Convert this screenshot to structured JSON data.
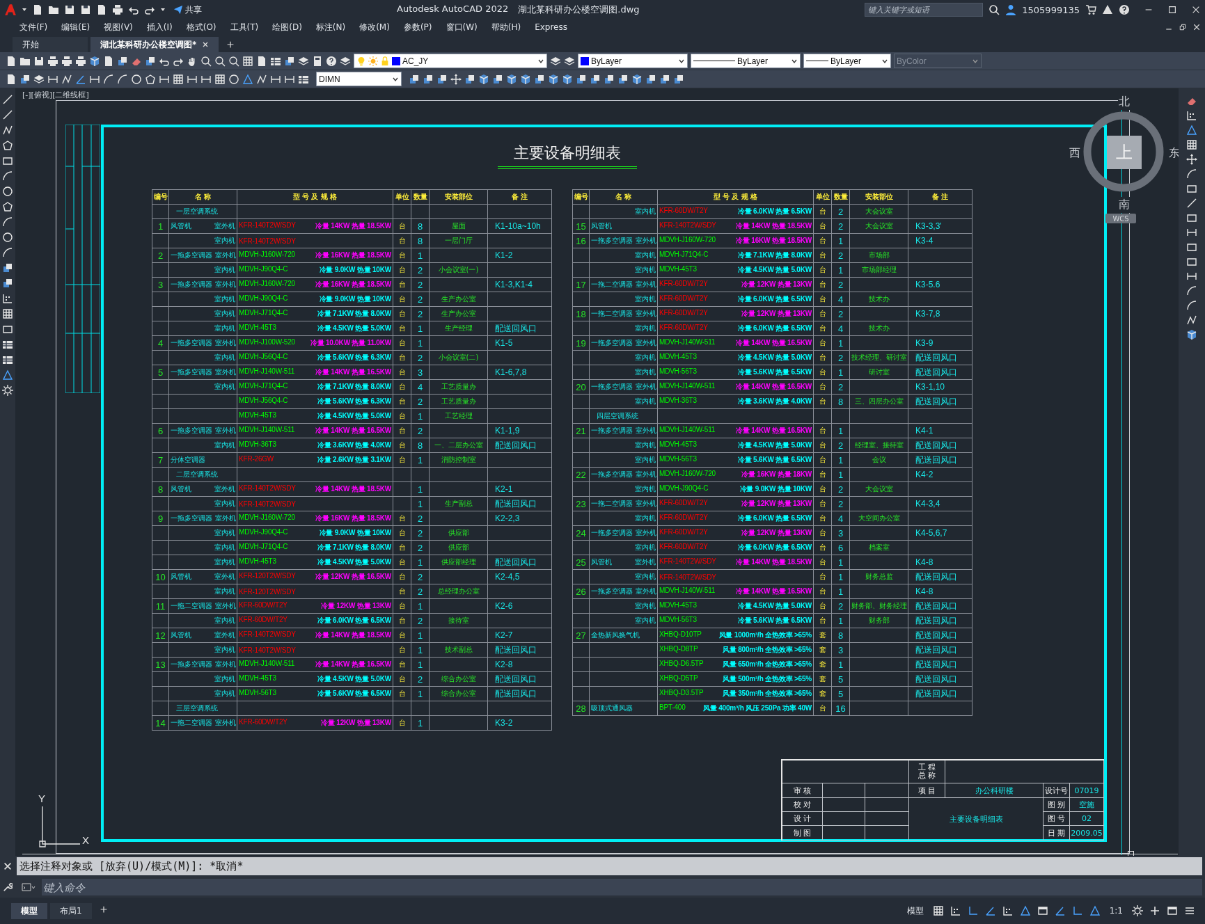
{
  "title_bar": {
    "share_label": "共享",
    "app_title": "Autodesk AutoCAD 2022",
    "file_name": "湖北某科研办公楼空调图.dwg",
    "search_placeholder": "键入关键字或短语",
    "user_name": "1505999135"
  },
  "menu": [
    "文件(F)",
    "编辑(E)",
    "视图(V)",
    "插入(I)",
    "格式(O)",
    "工具(T)",
    "绘图(D)",
    "标注(N)",
    "修改(M)",
    "参数(P)",
    "窗口(W)",
    "帮助(H)",
    "Express"
  ],
  "doc_tabs": [
    {
      "label": "开始",
      "selected": false
    },
    {
      "label": "湖北某科研办公楼空调图*",
      "selected": true
    }
  ],
  "toolbar": {
    "layer": "AC_JY",
    "color_value": "ByLayer",
    "swatch": {
      "color": "#0000ff"
    },
    "linetype": "ByLayer",
    "lineweight": "ByLayer",
    "plot_style": {
      "label": "ByColor",
      "disabled": true
    },
    "dim_style": "DIMN"
  },
  "viewport_label": "[-][俯视][二维线框]",
  "drawing": {
    "title": "主要设备明细表",
    "tables": [
      {
        "columns": [
          "编号",
          "名 称",
          "型 号 及 规 格",
          "单位",
          "数量",
          "安装部位",
          "备 注"
        ],
        "rows": [
          {
            "kind": "section",
            "name": "一层空调系统"
          },
          {
            "kind": "item",
            "no": "1",
            "name": "风管机",
            "sub": "室外机",
            "model": {
              "text": "KFR-140T2W/SDY",
              "color": "#ff0000"
            },
            "spec": {
              "text": "冷量 14KW 热量 18.5KW",
              "color": "#ff00ff"
            },
            "unit": "台",
            "qty": "8",
            "location": "屋面",
            "remark": "K1-10a~10h"
          },
          {
            "kind": "item",
            "sub": "室内机",
            "model": {
              "text": "KFR-140T2W/SDY",
              "color": "#ff0000"
            },
            "unit": "台",
            "qty": "8",
            "location": "一层门厅"
          },
          {
            "kind": "item",
            "no": "2",
            "name": "一拖多空调器",
            "sub": "室外机",
            "model": {
              "text": "MDVH-J160W-720",
              "color": "#00ff00"
            },
            "spec": {
              "text": "冷量 16KW 热量 18.5KW",
              "color": "#ff00ff"
            },
            "unit": "台",
            "qty": "1",
            "remark": "K1-2"
          },
          {
            "kind": "item",
            "sub": "室内机",
            "model": {
              "text": "MDVH-J90Q4-C",
              "color": "#00ff00"
            },
            "spec": {
              "text": "冷量 9.0KW 热量 10KW",
              "color": "#00ffff"
            },
            "unit": "台",
            "qty": "2",
            "location": "小会议室(一)"
          },
          {
            "kind": "item",
            "no": "3",
            "name": "一拖多空调器",
            "sub": "室外机",
            "model": {
              "text": "MDVH-J160W-720",
              "color": "#00ff00"
            },
            "spec": {
              "text": "冷量 16KW 热量 18.5KW",
              "color": "#ff00ff"
            },
            "unit": "台",
            "qty": "2",
            "remark": "K1-3,K1-4"
          },
          {
            "kind": "item",
            "sub": "室内机",
            "model": {
              "text": "MDVH-J90Q4-C",
              "color": "#00ff00"
            },
            "spec": {
              "text": "冷量 9.0KW 热量 10KW",
              "color": "#00ffff"
            },
            "unit": "台",
            "qty": "2",
            "location": "生产办公室"
          },
          {
            "kind": "item",
            "sub": "室内机",
            "model": {
              "text": "MDVH-J71Q4-C",
              "color": "#00ff00"
            },
            "spec": {
              "text": "冷量 7.1KW 热量 8.0KW",
              "color": "#00ffff"
            },
            "unit": "台",
            "qty": "2",
            "location": "生产办公室"
          },
          {
            "kind": "item",
            "sub": "室内机",
            "model": {
              "text": "MDVH-45T3",
              "color": "#00ff00"
            },
            "spec": {
              "text": "冷量 4.5KW 热量 5.0KW",
              "color": "#00ffff"
            },
            "unit": "台",
            "qty": "1",
            "location": "生产经理",
            "remark": "配送回风口"
          },
          {
            "kind": "item",
            "no": "4",
            "name": "一拖多空调器",
            "sub": "室外机",
            "model": {
              "text": "MDVH-J100W-520",
              "color": "#00ff00"
            },
            "spec": {
              "text": "冷量 10.0KW 热量 11.0KW",
              "color": "#ff00ff"
            },
            "unit": "台",
            "qty": "1",
            "remark": "K1-5"
          },
          {
            "kind": "item",
            "sub": "室内机",
            "model": {
              "text": "MDVH-J56Q4-C",
              "color": "#00ff00"
            },
            "spec": {
              "text": "冷量 5.6KW 热量 6.3KW",
              "color": "#00ffff"
            },
            "unit": "台",
            "qty": "2",
            "location": "小会议室(二)"
          },
          {
            "kind": "item",
            "no": "5",
            "name": "一拖多空调器",
            "sub": "室外机",
            "model": {
              "text": "MDVH-J140W-511",
              "color": "#00ff00"
            },
            "spec": {
              "text": "冷量 14KW 热量 16.5KW",
              "color": "#ff00ff"
            },
            "unit": "台",
            "qty": "3",
            "remark": "K1-6,7,8"
          },
          {
            "kind": "item",
            "sub": "室内机",
            "model": {
              "text": "MDVH-J71Q4-C",
              "color": "#00ff00"
            },
            "spec": {
              "text": "冷量 7.1KW 热量 8.0KW",
              "color": "#00ffff"
            },
            "unit": "台",
            "qty": "4",
            "location": "工艺质量办"
          },
          {
            "kind": "item",
            "model": {
              "text": "MDVH-J56Q4-C",
              "color": "#00ff00"
            },
            "spec": {
              "text": "冷量 5.6KW 热量 6.3KW",
              "color": "#00ffff"
            },
            "unit": "台",
            "qty": "2",
            "location": "工艺质量办"
          },
          {
            "kind": "item",
            "model": {
              "text": "MDVH-45T3",
              "color": "#00ff00"
            },
            "spec": {
              "text": "冷量 4.5KW 热量 5.0KW",
              "color": "#00ffff"
            },
            "unit": "台",
            "qty": "1",
            "location": "工艺经理"
          },
          {
            "kind": "item",
            "no": "6",
            "name": "一拖多空调器",
            "sub": "室外机",
            "model": {
              "text": "MDVH-J140W-511",
              "color": "#00ff00"
            },
            "spec": {
              "text": "冷量 14KW 热量 16.5KW",
              "color": "#ff00ff"
            },
            "unit": "台",
            "qty": "2",
            "remark": "K1-1,9"
          },
          {
            "kind": "item",
            "sub": "室内机",
            "model": {
              "text": "MDVH-36T3",
              "color": "#00ff00"
            },
            "spec": {
              "text": "冷量 3.6KW 热量 4.0KW",
              "color": "#00ffff"
            },
            "unit": "台",
            "qty": "8",
            "location": "一、二层办公室",
            "remark": "配送回风口"
          },
          {
            "kind": "item",
            "no": "7",
            "name": "分体空调器",
            "model": {
              "text": "KFR-26GW",
              "color": "#ff0000"
            },
            "spec": {
              "text": "冷量 2.6KW 热量 3.1KW",
              "color": "#00ffff"
            },
            "unit": "台",
            "qty": "1",
            "location": "消防控制室"
          },
          {
            "kind": "section",
            "name": "二层空调系统"
          },
          {
            "kind": "item",
            "no": "8",
            "name": "风管机",
            "sub": "室外机",
            "model": {
              "text": "KFR-140T2W/SDY",
              "color": "#ff0000"
            },
            "spec": {
              "text": "冷量 14KW 热量 18.5KW",
              "color": "#ff00ff"
            },
            "qty": "1",
            "remark": "K2-1"
          },
          {
            "kind": "item",
            "sub": "室内机",
            "model": {
              "text": "KFR-140T2W/SDY",
              "color": "#ff0000"
            },
            "qty": "1",
            "location": "生产副总",
            "remark": "配送回风口"
          },
          {
            "kind": "item",
            "no": "9",
            "name": "一拖多空调器",
            "sub": "室外机",
            "model": {
              "text": "MDVH-J160W-720",
              "color": "#00ff00"
            },
            "spec": {
              "text": "冷量 16KW 热量 18.5KW",
              "color": "#ff00ff"
            },
            "unit": "台",
            "qty": "2",
            "remark": "K2-2,3"
          },
          {
            "kind": "item",
            "sub": "室内机",
            "model": {
              "text": "MDVH-J90Q4-C",
              "color": "#00ff00"
            },
            "spec": {
              "text": "冷量 9.0KW 热量 10KW",
              "color": "#00ffff"
            },
            "unit": "台",
            "qty": "2",
            "location": "供应部"
          },
          {
            "kind": "item",
            "sub": "室内机",
            "model": {
              "text": "MDVH-J71Q4-C",
              "color": "#00ff00"
            },
            "spec": {
              "text": "冷量 7.1KW 热量 8.0KW",
              "color": "#00ffff"
            },
            "unit": "台",
            "qty": "2",
            "location": "供应部"
          },
          {
            "kind": "item",
            "sub": "室内机",
            "model": {
              "text": "MDVH-45T3",
              "color": "#00ff00"
            },
            "spec": {
              "text": "冷量 4.5KW 热量 5.0KW",
              "color": "#00ffff"
            },
            "unit": "台",
            "qty": "1",
            "location": "供应部经理",
            "remark": "配送回风口"
          },
          {
            "kind": "item",
            "no": "10",
            "name": "风管机",
            "sub": "室外机",
            "model": {
              "text": "KFR-120T2W/SDY",
              "color": "#ff0000"
            },
            "spec": {
              "text": "冷量 12KW 热量 16.5KW",
              "color": "#ff00ff"
            },
            "unit": "台",
            "qty": "2",
            "remark": "K2-4,5"
          },
          {
            "kind": "item",
            "sub": "室内机",
            "model": {
              "text": "KFR-120T2W/SDY",
              "color": "#ff0000"
            },
            "unit": "台",
            "qty": "2",
            "location": "总经理办公室"
          },
          {
            "kind": "item",
            "no": "11",
            "name": "一拖二空调器",
            "sub": "室外机",
            "model": {
              "text": "KFR-60DW/T2Y",
              "color": "#ff0000"
            },
            "spec": {
              "text": "冷量 12KW 热量 13KW",
              "color": "#ff00ff"
            },
            "unit": "台",
            "qty": "1",
            "remark": "K2-6"
          },
          {
            "kind": "item",
            "sub": "室内机",
            "model": {
              "text": "KFR-60DW/T2Y",
              "color": "#ff0000"
            },
            "spec": {
              "text": "冷量 6.0KW 热量 6.5KW",
              "color": "#00ffff"
            },
            "unit": "台",
            "qty": "2",
            "location": "接待室"
          },
          {
            "kind": "item",
            "no": "12",
            "name": "风管机",
            "sub": "室外机",
            "model": {
              "text": "KFR-140T2W/SDY",
              "color": "#ff0000"
            },
            "spec": {
              "text": "冷量 14KW 热量 18.5KW",
              "color": "#ff00ff"
            },
            "unit": "台",
            "qty": "1",
            "remark": "K2-7"
          },
          {
            "kind": "item",
            "sub": "室内机",
            "model": {
              "text": "KFR-140T2W/SDY",
              "color": "#ff0000"
            },
            "unit": "台",
            "qty": "1",
            "location": "技术副总",
            "remark": "配送回风口"
          },
          {
            "kind": "item",
            "no": "13",
            "name": "一拖多空调器",
            "sub": "室外机",
            "model": {
              "text": "MDVH-J140W-511",
              "color": "#00ff00"
            },
            "spec": {
              "text": "冷量 14KW 热量 16.5KW",
              "color": "#ff00ff"
            },
            "unit": "台",
            "qty": "1",
            "remark": "K2-8"
          },
          {
            "kind": "item",
            "sub": "室内机",
            "model": {
              "text": "MDVH-45T3",
              "color": "#00ff00"
            },
            "spec": {
              "text": "冷量 4.5KW 热量 5.0KW",
              "color": "#00ffff"
            },
            "unit": "台",
            "qty": "2",
            "location": "综合办公室",
            "remark": "配送回风口"
          },
          {
            "kind": "item",
            "sub": "室内机",
            "model": {
              "text": "MDVH-56T3",
              "color": "#00ff00"
            },
            "spec": {
              "text": "冷量 5.6KW 热量 6.5KW",
              "color": "#00ffff"
            },
            "unit": "台",
            "qty": "1",
            "location": "综合办公室",
            "remark": "配送回风口"
          },
          {
            "kind": "section",
            "name": "三层空调系统"
          },
          {
            "kind": "item",
            "no": "14",
            "name": "一拖二空调器",
            "sub": "室外机",
            "model": {
              "text": "KFR-60DW/T2Y",
              "color": "#ff0000"
            },
            "spec": {
              "text": "冷量 12KW 热量 13KW",
              "color": "#ff00ff"
            },
            "unit": "台",
            "qty": "1",
            "remark": "K3-2"
          }
        ]
      },
      {
        "columns": [
          "编号",
          "名 称",
          "型 号 及 规 格",
          "单位",
          "数量",
          "安装部位",
          "备 注"
        ],
        "rows": [
          {
            "kind": "item",
            "sub": "室内机",
            "model": {
              "text": "KFR-60DW/T2Y",
              "color": "#ff0000"
            },
            "spec": {
              "text": "冷量 6.0KW 热量 6.5KW",
              "color": "#00ffff"
            },
            "unit": "台",
            "qty": "2",
            "location": "大会议室"
          },
          {
            "kind": "item",
            "no": "15",
            "name": "风管机",
            "model": {
              "text": "KFR-140T2W/SDY",
              "color": "#ff0000"
            },
            "spec": {
              "text": "冷量 14KW 热量 18.5KW",
              "color": "#ff00ff"
            },
            "unit": "台",
            "qty": "2",
            "location": "大会议室",
            "remark": "K3-3,3'"
          },
          {
            "kind": "item",
            "no": "16",
            "name": "一拖多空调器",
            "sub": "室外机",
            "model": {
              "text": "MDVH-J160W-720",
              "color": "#00ff00"
            },
            "spec": {
              "text": "冷量 16KW 热量 18.5KW",
              "color": "#ff00ff"
            },
            "unit": "台",
            "qty": "1",
            "remark": "K3-4"
          },
          {
            "kind": "item",
            "sub": "室内机",
            "model": {
              "text": "MDVH-J71Q4-C",
              "color": "#00ff00"
            },
            "spec": {
              "text": "冷量 7.1KW 热量 8.0KW",
              "color": "#00ffff"
            },
            "unit": "台",
            "qty": "2",
            "location": "市场部"
          },
          {
            "kind": "item",
            "sub": "室内机",
            "model": {
              "text": "MDVH-45T3",
              "color": "#00ff00"
            },
            "spec": {
              "text": "冷量 4.5KW 热量 5.0KW",
              "color": "#00ffff"
            },
            "unit": "台",
            "qty": "1",
            "location": "市场部经理"
          },
          {
            "kind": "item",
            "no": "17",
            "name": "一拖二空调器",
            "sub": "室外机",
            "model": {
              "text": "KFR-60DW/T2Y",
              "color": "#ff0000"
            },
            "spec": {
              "text": "冷量 12KW 热量 13KW",
              "color": "#ff00ff"
            },
            "unit": "台",
            "qty": "2",
            "remark": "K3-5.6"
          },
          {
            "kind": "item",
            "sub": "室内机",
            "model": {
              "text": "KFR-60DW/T2Y",
              "color": "#ff0000"
            },
            "spec": {
              "text": "冷量 6.0KW 热量 6.5KW",
              "color": "#00ffff"
            },
            "unit": "台",
            "qty": "4",
            "location": "技术办"
          },
          {
            "kind": "item",
            "no": "18",
            "name": "一拖二空调器",
            "sub": "室外机",
            "model": {
              "text": "KFR-60DW/T2Y",
              "color": "#ff0000"
            },
            "spec": {
              "text": "冷量 12KW 热量 13KW",
              "color": "#ff00ff"
            },
            "unit": "台",
            "qty": "2",
            "remark": "K3-7,8"
          },
          {
            "kind": "item",
            "sub": "室内机",
            "model": {
              "text": "KFR-60DW/T2Y",
              "color": "#ff0000"
            },
            "spec": {
              "text": "冷量 6.0KW 热量 6.5KW",
              "color": "#00ffff"
            },
            "unit": "台",
            "qty": "4",
            "location": "技术办"
          },
          {
            "kind": "item",
            "no": "19",
            "name": "一拖多空调器",
            "sub": "室外机",
            "model": {
              "text": "MDVH-J140W-511",
              "color": "#00ff00"
            },
            "spec": {
              "text": "冷量 14KW 热量 16.5KW",
              "color": "#ff00ff"
            },
            "unit": "台",
            "qty": "1",
            "remark": "K3-9"
          },
          {
            "kind": "item",
            "sub": "室内机",
            "model": {
              "text": "MDVH-45T3",
              "color": "#00ff00"
            },
            "spec": {
              "text": "冷量 4.5KW 热量 5.0KW",
              "color": "#00ffff"
            },
            "unit": "台",
            "qty": "2",
            "location": "技术经理、研讨室",
            "remark": "配送回风口"
          },
          {
            "kind": "item",
            "sub": "室内机",
            "model": {
              "text": "MDVH-56T3",
              "color": "#00ff00"
            },
            "spec": {
              "text": "冷量 5.6KW 热量 6.5KW",
              "color": "#00ffff"
            },
            "unit": "台",
            "qty": "1",
            "location": "研讨室",
            "remark": "配送回风口"
          },
          {
            "kind": "item",
            "no": "20",
            "name": "一拖多空调器",
            "sub": "室外机",
            "model": {
              "text": "MDVH-J140W-511",
              "color": "#00ff00"
            },
            "spec": {
              "text": "冷量 14KW 热量 16.5KW",
              "color": "#ff00ff"
            },
            "unit": "台",
            "qty": "2",
            "remark": "K3-1,10"
          },
          {
            "kind": "item",
            "sub": "室内机",
            "model": {
              "text": "MDVH-36T3",
              "color": "#00ff00"
            },
            "spec": {
              "text": "冷量 3.6KW 热量 4.0KW",
              "color": "#00ffff"
            },
            "unit": "台",
            "qty": "8",
            "location": "三、四层办公室",
            "remark": "配送回风口"
          },
          {
            "kind": "section",
            "name": "四层空调系统"
          },
          {
            "kind": "item",
            "no": "21",
            "name": "一拖多空调器",
            "sub": "室外机",
            "model": {
              "text": "MDVH-J140W-511",
              "color": "#00ff00"
            },
            "spec": {
              "text": "冷量 14KW 热量 16.5KW",
              "color": "#ff00ff"
            },
            "unit": "台",
            "qty": "1",
            "remark": "K4-1"
          },
          {
            "kind": "item",
            "sub": "室内机",
            "model": {
              "text": "MDVH-45T3",
              "color": "#00ff00"
            },
            "spec": {
              "text": "冷量 4.5KW 热量 5.0KW",
              "color": "#00ffff"
            },
            "unit": "台",
            "qty": "2",
            "location": "经理室、接待室",
            "remark": "配送回风口"
          },
          {
            "kind": "item",
            "sub": "室内机",
            "model": {
              "text": "MDVH-56T3",
              "color": "#00ff00"
            },
            "spec": {
              "text": "冷量 5.6KW 热量 6.5KW",
              "color": "#00ffff"
            },
            "unit": "台",
            "qty": "1",
            "location": "会议",
            "remark": "配送回风口"
          },
          {
            "kind": "item",
            "no": "22",
            "name": "一拖多空调器",
            "sub": "室外机",
            "model": {
              "text": "MDVH-J160W-720",
              "color": "#00ff00"
            },
            "spec": {
              "text": "冷量 16KW 热量 18KW",
              "color": "#ff00ff"
            },
            "unit": "台",
            "qty": "1",
            "remark": "K4-2"
          },
          {
            "kind": "item",
            "sub": "室内机",
            "model": {
              "text": "MDVH-J90Q4-C",
              "color": "#00ff00"
            },
            "spec": {
              "text": "冷量 9.0KW 热量 10KW",
              "color": "#00ffff"
            },
            "unit": "台",
            "qty": "2",
            "location": "大会议室"
          },
          {
            "kind": "item",
            "no": "23",
            "name": "一拖二空调器",
            "sub": "室外机",
            "model": {
              "text": "KFR-60DW/T2Y",
              "color": "#ff0000"
            },
            "spec": {
              "text": "冷量 12KW 热量 13KW",
              "color": "#ff00ff"
            },
            "unit": "台",
            "qty": "2",
            "remark": "K4-3,4"
          },
          {
            "kind": "item",
            "sub": "室内机",
            "model": {
              "text": "KFR-60DW/T2Y",
              "color": "#ff0000"
            },
            "spec": {
              "text": "冷量 6.0KW 热量 6.5KW",
              "color": "#00ffff"
            },
            "unit": "台",
            "qty": "4",
            "location": "大空间办公室"
          },
          {
            "kind": "item",
            "no": "24",
            "name": "一拖多空调器",
            "sub": "室外机",
            "model": {
              "text": "KFR-60DW/T2Y",
              "color": "#ff0000"
            },
            "spec": {
              "text": "冷量 12KW 热量 13KW",
              "color": "#ff00ff"
            },
            "unit": "台",
            "qty": "3",
            "remark": "K4-5,6,7"
          },
          {
            "kind": "item",
            "sub": "室内机",
            "model": {
              "text": "KFR-60DW/T2Y",
              "color": "#ff0000"
            },
            "spec": {
              "text": "冷量 6.0KW 热量 6.5KW",
              "color": "#00ffff"
            },
            "unit": "台",
            "qty": "6",
            "location": "档案室"
          },
          {
            "kind": "item",
            "no": "25",
            "name": "风管机",
            "sub": "室外机",
            "model": {
              "text": "KFR-140T2W/SDY",
              "color": "#ff0000"
            },
            "spec": {
              "text": "冷量 14KW 热量 18.5KW",
              "color": "#ff00ff"
            },
            "unit": "台",
            "qty": "1",
            "remark": "K4-8"
          },
          {
            "kind": "item",
            "sub": "室内机",
            "model": {
              "text": "KFR-140T2W/SDY",
              "color": "#ff0000"
            },
            "unit": "台",
            "qty": "1",
            "location": "财务总监",
            "remark": "配送回风口"
          },
          {
            "kind": "item",
            "no": "26",
            "name": "一拖多空调器",
            "sub": "室外机",
            "model": {
              "text": "MDVH-J140W-511",
              "color": "#00ff00"
            },
            "spec": {
              "text": "冷量 14KW 热量 16.5KW",
              "color": "#ff00ff"
            },
            "unit": "台",
            "qty": "1",
            "remark": "K4-8"
          },
          {
            "kind": "item",
            "sub": "室内机",
            "model": {
              "text": "MDVH-45T3",
              "color": "#00ff00"
            },
            "spec": {
              "text": "冷量 4.5KW 热量 5.0KW",
              "color": "#00ffff"
            },
            "unit": "台",
            "qty": "2",
            "location": "财务部、财务经理",
            "remark": "配送回风口"
          },
          {
            "kind": "item",
            "sub": "室内机",
            "model": {
              "text": "MDVH-56T3",
              "color": "#00ff00"
            },
            "spec": {
              "text": "冷量 5.6KW 热量 6.5KW",
              "color": "#00ffff"
            },
            "unit": "台",
            "qty": "1",
            "location": "财务部",
            "remark": "配送回风口"
          },
          {
            "kind": "item",
            "no": "27",
            "name": "全热新风换气机",
            "model": {
              "text": "XHBQ-D10TP",
              "color": "#00ff00"
            },
            "spec": {
              "text": "风量 1000m³/h 全热效率 >65%",
              "color": "#00ffff"
            },
            "unit": "套",
            "qty": "8",
            "remark": "配送回风口"
          },
          {
            "kind": "item",
            "model": {
              "text": "XHBQ-D8TP",
              "color": "#00ff00"
            },
            "spec": {
              "text": "风量 800m³/h 全热效率 >65%",
              "color": "#00ffff"
            },
            "unit": "套",
            "qty": "3",
            "remark": "配送回风口"
          },
          {
            "kind": "item",
            "model": {
              "text": "XHBQ-D6.5TP",
              "color": "#00ff00"
            },
            "spec": {
              "text": "风量 650m³/h 全热效率 >65%",
              "color": "#00ffff"
            },
            "unit": "套",
            "qty": "1",
            "remark": "配送回风口"
          },
          {
            "kind": "item",
            "model": {
              "text": "XHBQ-D5TP",
              "color": "#00ff00"
            },
            "spec": {
              "text": "风量 500m³/h 全热效率 >65%",
              "color": "#00ffff"
            },
            "unit": "套",
            "qty": "5",
            "remark": "配送回风口"
          },
          {
            "kind": "item",
            "model": {
              "text": "XHBQ-D3.5TP",
              "color": "#00ff00"
            },
            "spec": {
              "text": "风量 350m³/h 全热效率 >65%",
              "color": "#00ffff"
            },
            "unit": "套",
            "qty": "5",
            "remark": "配送回风口"
          },
          {
            "kind": "item",
            "no": "28",
            "name": "吸顶式通风器",
            "model": {
              "text": "BPT-400",
              "color": "#00ff00"
            },
            "spec": {
              "text": "风量 400m³/h 风压 250Pa 功率 40W",
              "color": "#00ffff"
            },
            "unit": "台",
            "qty": "16"
          }
        ]
      }
    ]
  },
  "title_block": {
    "project_label_lines": [
      "工 程",
      "总 称"
    ],
    "signoff_labels": [
      "审 核",
      "校 对",
      "设 计",
      "制 图"
    ],
    "item_label": "项 目",
    "item_value": "办公科研楼",
    "drawing_name": "主要设备明细表",
    "fields": [
      {
        "label": "设计号",
        "value": "07019"
      },
      {
        "label": "图 别",
        "value": "空施"
      },
      {
        "label": "图 号",
        "value": "02"
      },
      {
        "label": "日 期",
        "value": "2009.05"
      }
    ]
  },
  "viewcube": {
    "north": "北",
    "south": "南",
    "west": "西",
    "east": "东",
    "face": "上",
    "ucs": "WCS"
  },
  "ucs_icon": {
    "x": "X",
    "y": "Y"
  },
  "command_line": {
    "history": "选择注释对象或 [放弃(U)/模式(M)]: *取消*",
    "placeholder": "键入命令"
  },
  "layout_tabs": [
    {
      "label": "模型",
      "selected": true
    },
    {
      "label": "布局1",
      "selected": false
    }
  ],
  "status_bar": {
    "space": "模型",
    "scale": "1:1"
  }
}
